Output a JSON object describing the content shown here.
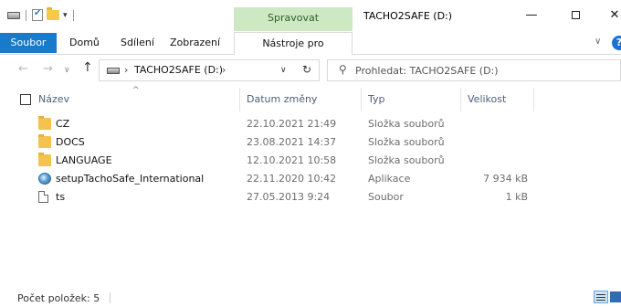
{
  "title_bar": {
    "window_title": "TACHO2SAFE (D:)",
    "tool_tab_header": "Spravovat",
    "minimize": "—",
    "close": "✕"
  },
  "ribbon": {
    "tabs": [
      {
        "label": "Soubor"
      },
      {
        "label": "Domů"
      },
      {
        "label": "Sdílení"
      },
      {
        "label": "Zobrazení"
      },
      {
        "label": "Nástroje pro jednotky"
      }
    ],
    "expand_glyph": "∨",
    "help_glyph": "?"
  },
  "navigation": {
    "back": "←",
    "forward": "→",
    "recent": "∨",
    "up": "↑",
    "address": "TACHO2SAFE (D:)",
    "chevron": "›",
    "address_dropdown": "∨",
    "refresh": "↻",
    "search_icon": "⚲",
    "search_placeholder": "Prohledat: TACHO2SAFE (D:)"
  },
  "columns": {
    "name": "Název",
    "date": "Datum změny",
    "type": "Typ",
    "size": "Velikost",
    "sort_glyph": "^"
  },
  "files": [
    {
      "name": "CZ",
      "date": "22.10.2021 21:49",
      "type": "Složka souborů",
      "size": "",
      "icon": "folder-icon"
    },
    {
      "name": "DOCS",
      "date": "23.08.2021 14:37",
      "type": "Složka souborů",
      "size": "",
      "icon": "folder-icon"
    },
    {
      "name": "LANGUAGE",
      "date": "12.10.2021 10:58",
      "type": "Složka souborů",
      "size": "",
      "icon": "folder-icon"
    },
    {
      "name": "setupTachoSafe_International",
      "date": "22.11.2020 10:42",
      "type": "Aplikace",
      "size": "7 934 kB",
      "icon": "setup-app-icon"
    },
    {
      "name": "ts",
      "date": "27.05.2013 9:24",
      "type": "Soubor",
      "size": "1 kB",
      "icon": "file-icon"
    }
  ],
  "status_bar": {
    "item_count": "Počet položek: 5"
  },
  "colors": {
    "file_tab": "#1979ca",
    "tool_tab": "#cde9c4",
    "column_header_text": "#4c607a",
    "folder": "#f4c34f"
  }
}
